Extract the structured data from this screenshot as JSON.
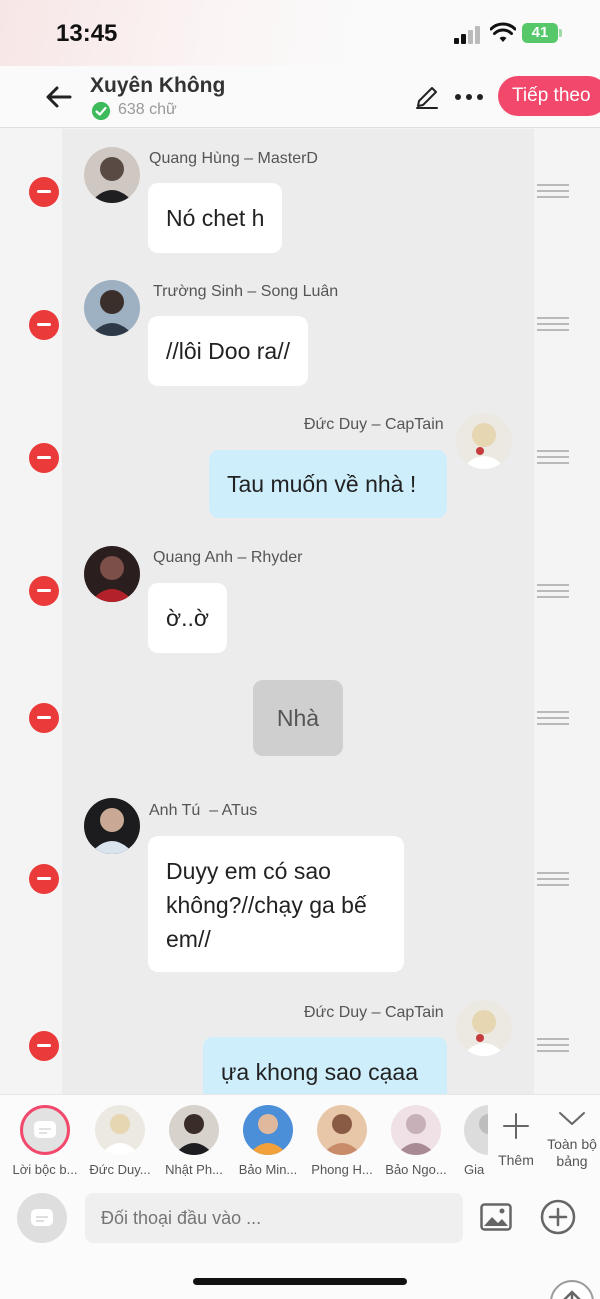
{
  "status": {
    "time": "13:45",
    "battery": "41"
  },
  "header": {
    "title": "Xuyên Không",
    "word_count": "638 chữ",
    "next_label": "Tiếp theo"
  },
  "messages": [
    {
      "speaker": "Quang Hùng – MasterD",
      "text": "Nó chet h",
      "side": "left"
    },
    {
      "speaker": "Trường Sinh – Song Luân",
      "text": "//lôi Doo ra//",
      "side": "left"
    },
    {
      "speaker": "Đức Duy – CapTain",
      "text": "Tau muốn về nhà !",
      "side": "right"
    },
    {
      "speaker": "Quang Anh – Rhyder",
      "text": "ờ..ờ",
      "side": "left"
    },
    {
      "speaker": "",
      "text": "Nhà",
      "side": "narration"
    },
    {
      "speaker": "Anh Tú  – ATus",
      "text": "Duyy em có sao không?//chạy ga bế em//",
      "side": "left"
    },
    {
      "speaker": "Đức Duy – CapTain",
      "text": "ựa khong sao cạaa",
      "side": "right"
    }
  ],
  "characters": [
    {
      "label": "Lời bộc b...",
      "icon": "narrator-icon"
    },
    {
      "label": "Đức Duy..."
    },
    {
      "label": "Nhật Ph..."
    },
    {
      "label": "Bảo Min..."
    },
    {
      "label": "Phong H..."
    },
    {
      "label": "Bảo Ngo..."
    },
    {
      "label": "Gia"
    }
  ],
  "char_bar": {
    "add_label": "Thêm",
    "toggle_label": "Toàn bộ bảng"
  },
  "input": {
    "placeholder": "Đối thoại đầu vào ..."
  },
  "colors": {
    "accent": "#f2486c",
    "remove": "#ea3a3a",
    "self_bubble": "#cdeefa",
    "narration_bubble": "#cfcfd0",
    "verified": "#3dbb5a"
  }
}
